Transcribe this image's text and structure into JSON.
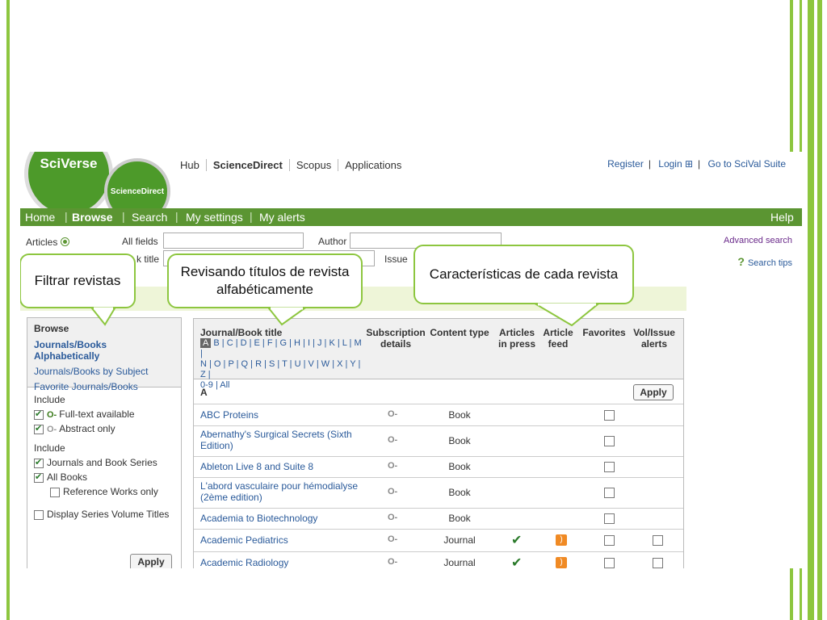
{
  "brand": {
    "logo_text": "SciVerse",
    "logo_sub": "ScienceDirect"
  },
  "topnav": [
    "Hub",
    "ScienceDirect",
    "Scopus",
    "Applications"
  ],
  "toplinks": {
    "register": "Register",
    "login": "Login ⊞",
    "scival": "Go to SciVal Suite"
  },
  "greenbar": {
    "home": "Home",
    "browse": "Browse",
    "search": "Search",
    "settings": "My settings",
    "alerts": "My alerts",
    "help": "Help"
  },
  "search": {
    "articles_label": "Articles",
    "allfields_label": "All fields",
    "author_label": "Author",
    "booktitle_label": "k title",
    "issue_label": "Issue",
    "advanced": "Advanced search",
    "tips": "Search tips"
  },
  "leftpanel": {
    "title": "Browse",
    "links": [
      "Journals/Books Alphabetically",
      "Journals/Books by Subject",
      "Favorite Journals/Books"
    ],
    "include1": "Include",
    "fulltext": "Full-text available",
    "abstract": "Abstract only",
    "include2": "Include",
    "series": "Journals and Book Series",
    "allbooks": "All Books",
    "reference": "Reference Works only",
    "display": "Display Series Volume Titles",
    "apply": "Apply"
  },
  "table": {
    "headers": {
      "title": "Journal/Book title",
      "subscription": "Subscription details",
      "content": "Content type",
      "articles": "Articles in press",
      "feed": "Article feed",
      "favorites": "Favorites",
      "alerts": "Vol/Issue alerts"
    },
    "alpha_current": "A",
    "alpha_line1": " B | C | D | E | F | G | H | I | J | K | L | M |",
    "alpha_line2": "N | O | P | Q | R | S | T | U | V | W | X | Y | Z |",
    "alpha_line3": "0-9 | All",
    "section": "A",
    "apply": "Apply",
    "rows": [
      {
        "title": "ABC Proteins",
        "type": "Book",
        "in_press": false,
        "feed": false,
        "alerts": false
      },
      {
        "title": "Abernathy's Surgical Secrets (Sixth Edition)",
        "type": "Book",
        "in_press": false,
        "feed": false,
        "alerts": false
      },
      {
        "title": "Ableton Live 8 and Suite 8",
        "type": "Book",
        "in_press": false,
        "feed": false,
        "alerts": false
      },
      {
        "title": "L'abord vasculaire pour hémodialyse (2ème edition)",
        "type": "Book",
        "in_press": false,
        "feed": false,
        "alerts": false
      },
      {
        "title": "Academia to Biotechnology",
        "type": "Book",
        "in_press": false,
        "feed": false,
        "alerts": false
      },
      {
        "title": "Academic Pediatrics",
        "type": "Journal",
        "in_press": true,
        "feed": true,
        "alerts": true
      },
      {
        "title": "Academic Radiology",
        "type": "Journal",
        "in_press": true,
        "feed": true,
        "alerts": true
      }
    ]
  },
  "callouts": {
    "filter": "Filtrar revistas",
    "alpha": "Revisando títulos de revista alfabéticamente",
    "features": "Características de cada revista"
  },
  "colors": {
    "accent": "#8dc63f",
    "navbar": "#5b9532",
    "link": "#2a5a9a"
  }
}
